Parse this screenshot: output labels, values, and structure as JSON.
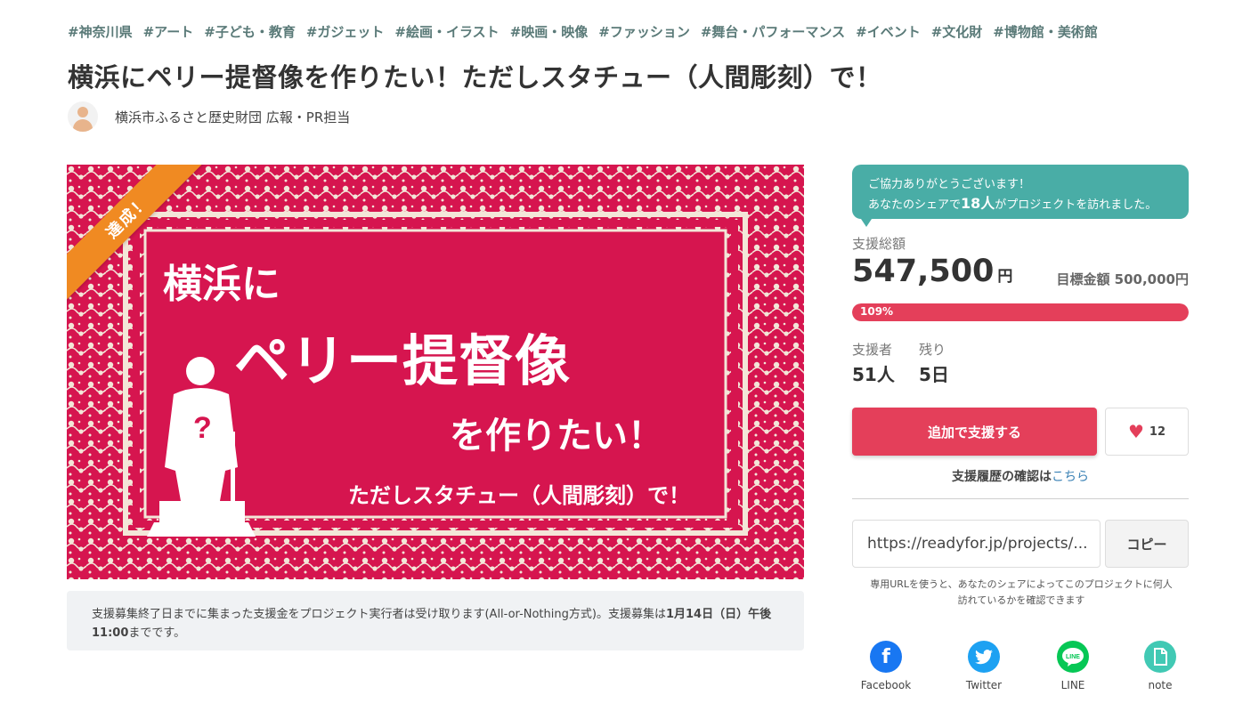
{
  "tags": [
    "#神奈川県",
    "#アート",
    "#子ども・教育",
    "#ガジェット",
    "#絵画・イラスト",
    "#映画・映像",
    "#ファッション",
    "#舞台・パフォーマンス",
    "#イベント",
    "#文化財",
    "#博物館・美術館"
  ],
  "title": "横浜にペリー提督像を作りたい！ただしスタチュー（人間彫刻）で！",
  "owner": {
    "name": "横浜市ふるさと歴史財団 広報・PR担当"
  },
  "hero": {
    "ribbon": "達成！",
    "line1": "横浜に",
    "line2": "ペリー提督像",
    "line3": "を作りたい！",
    "line4": "ただしスタチュー（人間彫刻）で！",
    "colors": {
      "background": "#d6154f",
      "ribbon": "#f08a22",
      "pattern": "#f3e6d8"
    }
  },
  "notice": {
    "text": "支援募集終了日までに集まった支援金をプロジェクト実行者は受け取ります(All-or-Nothing方式)。支援募集は",
    "deadline": "1月14日（日）午後11:00",
    "suffix": "までです。"
  },
  "sidebar": {
    "balloon": {
      "line1": "ご協力ありがとうございます！",
      "line2_prefix": "あなたのシェアで",
      "line2_count": "18人",
      "line2_suffix": "がプロジェクトを訪れました。"
    },
    "total_label": "支援総額",
    "total_amount": "547,500",
    "total_unit": "円",
    "goal": "目標金額 500,000円",
    "progress": {
      "percent": 109,
      "label": "109%"
    },
    "supporters_label": "支援者",
    "supporters_value": "51人",
    "remaining_label": "残り",
    "remaining_value": "5日",
    "support_button": "追加で支援する",
    "favorite_count": "12",
    "history_text": "支援履歴の確認は",
    "history_link": "こちら",
    "share_url": "https://readyfor.jp/projects/...",
    "copy_button": "コピー",
    "url_note": "専用URLを使うと、あなたのシェアによってこのプロジェクトに何人訪れているかを確認できます",
    "share_buttons": [
      {
        "name": "Facebook",
        "icon": "facebook-icon",
        "color": "#1877f2"
      },
      {
        "name": "Twitter",
        "icon": "twitter-icon",
        "color": "#1da1f2"
      },
      {
        "name": "LINE",
        "icon": "line-icon",
        "color": "#06c755"
      },
      {
        "name": "note",
        "icon": "note-icon",
        "color": "#41c9b4"
      }
    ],
    "colors": {
      "accent": "#e43f5a",
      "teal": "#49ada6"
    }
  }
}
